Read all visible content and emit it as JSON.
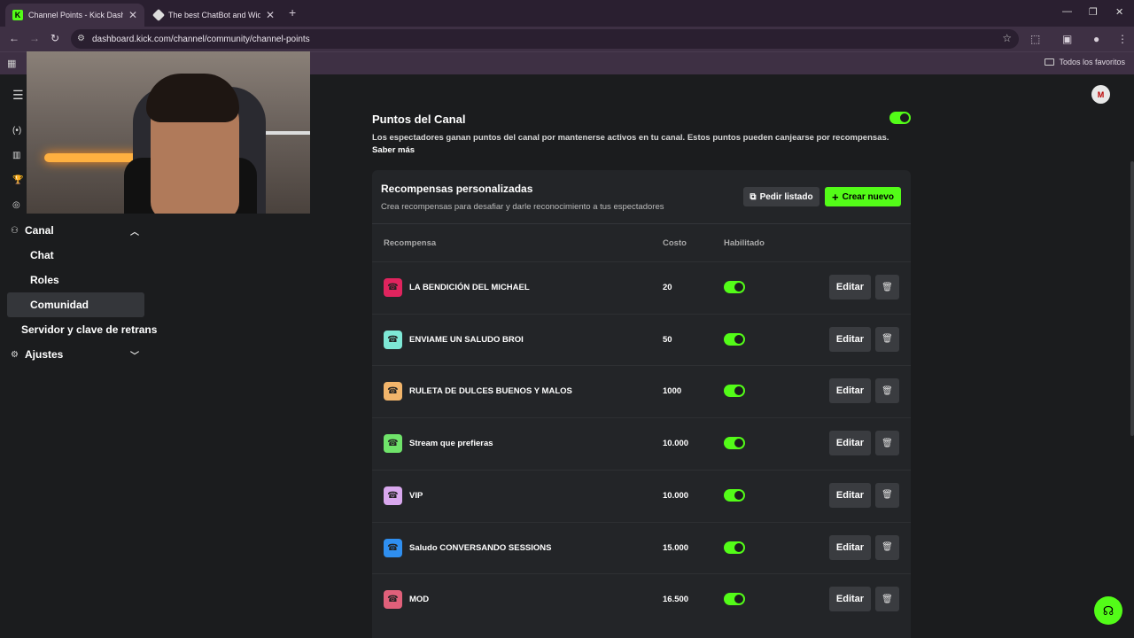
{
  "browser": {
    "tabs": [
      {
        "title": "Channel Points - Kick Dashboard",
        "favicon": "kick-logo"
      },
      {
        "title": "The best ChatBot and Widgets",
        "favicon": "diamond-logo"
      }
    ],
    "url": "dashboard.kick.com/channel/community/channel-points",
    "bookmarks_folder": "Todos los favoritos"
  },
  "user": {
    "avatar_initial": "M"
  },
  "sidebar": {
    "channel_label": "Canal",
    "channel_items": [
      "Chat",
      "Roles",
      "Comunidad"
    ],
    "active_item": "Comunidad",
    "server_link": "Servidor y clave de retrans",
    "settings_label": "Ajustes"
  },
  "channel_points": {
    "title": "Puntos del Canal",
    "description": "Los espectadores ganan puntos del canal por mantenerse activos en tu canal. Estos puntos pueden canjearse por recompensas.",
    "learn_more": "Saber más",
    "enabled": true
  },
  "rewards_panel": {
    "title": "Recompensas personalizadas",
    "subtitle": "Crea recompensas para desafiar y darle reconocimiento a tus espectadores",
    "request_list_button": "Pedir listado",
    "create_button": "Crear nuevo",
    "columns": {
      "reward": "Recompensa",
      "cost": "Costo",
      "enabled": "Habilitado"
    },
    "edit_label": "Editar",
    "rows": [
      {
        "name": "LA BENDICIÓN DEL MICHAEL",
        "cost": "20",
        "enabled": true,
        "color": "#e0245e"
      },
      {
        "name": "ENVIAME UN SALUDO BROI",
        "cost": "50",
        "enabled": true,
        "color": "#7ee8d6"
      },
      {
        "name": "RULETA DE DULCES BUENOS Y MALOS",
        "cost": "1000",
        "enabled": true,
        "color": "#f2b56b"
      },
      {
        "name": "Stream que prefieras",
        "cost": "10.000",
        "enabled": true,
        "color": "#6fe36a"
      },
      {
        "name": "VIP",
        "cost": "10.000",
        "enabled": true,
        "color": "#d9a8ee"
      },
      {
        "name": "Saludo CONVERSANDO SESSIONS",
        "cost": "15.000",
        "enabled": true,
        "color": "#2f8ff0"
      },
      {
        "name": "MOD",
        "cost": "16.500",
        "enabled": true,
        "color": "#e0607a"
      }
    ]
  },
  "colors": {
    "accent": "#53fc18",
    "background": "#1b1c1e",
    "panel": "#232528"
  }
}
